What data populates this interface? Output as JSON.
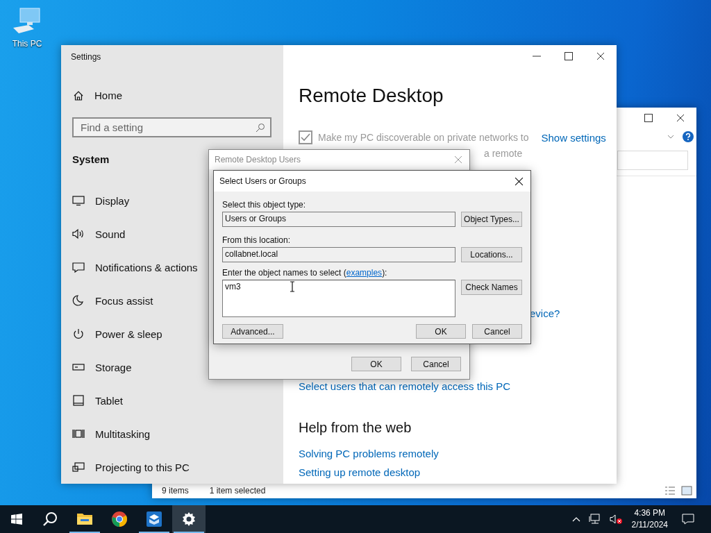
{
  "desktop": {
    "icons": [
      {
        "label": "This PC"
      }
    ]
  },
  "explorer_window": {
    "status_bar": {
      "item_count": "9 items",
      "selection": "1 item selected"
    }
  },
  "settings_window": {
    "title": "Settings",
    "sidebar": {
      "home": "Home",
      "search": {
        "placeholder": "Find a setting"
      },
      "section": "System",
      "items": [
        {
          "label": "Display",
          "kind": "display"
        },
        {
          "label": "Sound",
          "kind": "sound"
        },
        {
          "label": "Notifications & actions",
          "kind": "notifications"
        },
        {
          "label": "Focus assist",
          "kind": "focus"
        },
        {
          "label": "Power & sleep",
          "kind": "power"
        },
        {
          "label": "Storage",
          "kind": "storage"
        },
        {
          "label": "Tablet",
          "kind": "tablet"
        },
        {
          "label": "Multitasking",
          "kind": "multitasking"
        },
        {
          "label": "Projecting to this PC",
          "kind": "projecting"
        }
      ]
    },
    "page": {
      "title": "Remote Desktop",
      "discoverable": {
        "checked": true,
        "label": "Make my PC discoverable on private networks to",
        "label_fragment": "a remote"
      },
      "show_settings": "Show settings",
      "cut_link": "evice?",
      "select_users_link": "Select users that can remotely access this PC",
      "help_heading": "Help from the web",
      "help_links": [
        "Solving PC problems remotely",
        "Setting up remote desktop"
      ]
    }
  },
  "remote_desktop_users_dialog": {
    "title": "Remote Desktop Users",
    "buttons": [
      "OK",
      "Cancel"
    ]
  },
  "select_users_dialog": {
    "title": "Select Users or Groups",
    "object_type_label": "Select this object type:",
    "object_type": "Users or Groups",
    "object_types_button": "Object Types...",
    "location_label": "From this location:",
    "location": "collabnet.local",
    "locations_button": "Locations...",
    "names_label_before": "Enter the object names to select (",
    "examples_link": "examples",
    "names_label_after": "):",
    "names_value": "vm3",
    "check_names_button": "Check Names",
    "advanced_button": "Advanced...",
    "ok_button": "OK",
    "cancel_button": "Cancel"
  },
  "taskbar": {
    "apps": [
      {
        "kind": "explorer",
        "running": true,
        "active": false
      },
      {
        "kind": "chrome",
        "running": false,
        "active": false
      },
      {
        "kind": "app",
        "running": true,
        "active": false
      },
      {
        "kind": "settings",
        "running": true,
        "active": true
      }
    ],
    "time": "4:36 PM",
    "date": "2/11/2024"
  }
}
